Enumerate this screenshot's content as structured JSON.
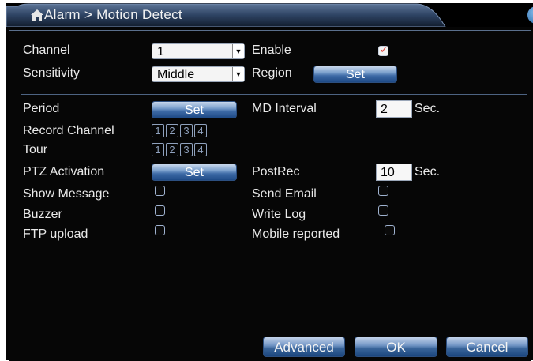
{
  "window": {
    "title": "Alarm > Motion Detect",
    "close_label": "×"
  },
  "fields": {
    "channel_label": "Channel",
    "channel_value": "1",
    "enable_label": "Enable",
    "enable_checked": true,
    "sensitivity_label": "Sensitivity",
    "sensitivity_value": "Middle",
    "region_label": "Region",
    "region_button": "Set",
    "period_label": "Period",
    "period_button": "Set",
    "md_interval_label": "MD Interval",
    "md_interval_value": "2",
    "md_interval_unit": "Sec.",
    "record_channel_label": "Record Channel",
    "record_channels": [
      "1",
      "2",
      "3",
      "4"
    ],
    "tour_label": "Tour",
    "tour_channels": [
      "1",
      "2",
      "3",
      "4"
    ],
    "ptz_label": "PTZ Activation",
    "ptz_button": "Set",
    "postrec_label": "PostRec",
    "postrec_value": "10",
    "postrec_unit": "Sec.",
    "show_message_label": "Show Message",
    "send_email_label": "Send Email",
    "buzzer_label": "Buzzer",
    "write_log_label": "Write Log",
    "ftp_label": "FTP upload",
    "mobile_label": "Mobile reported"
  },
  "buttons": {
    "advanced": "Advanced",
    "ok": "OK",
    "cancel": "Cancel"
  },
  "colors": {
    "accent": "#3d6aa6",
    "panel_border": "#5a6f8c",
    "check_mark": "#e0443a"
  }
}
